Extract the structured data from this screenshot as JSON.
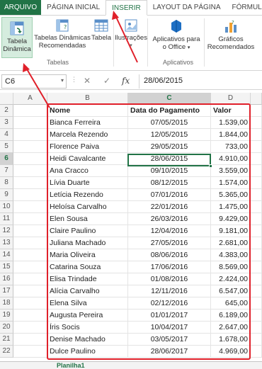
{
  "ribbon_tabs": [
    "ARQUIVO",
    "PÁGINA INICIAL",
    "INSERIR",
    "LAYOUT DA PÁGINA",
    "FÓRMULAS"
  ],
  "ribbon": {
    "pivot_table_label_1": "Tabela",
    "pivot_table_label_2": "Dinâmica",
    "rec_pivot_label_1": "Tabelas Dinâmicas",
    "rec_pivot_label_2": "Recomendadas",
    "table_label": "Tabela",
    "illustrations_label": "Ilustrações",
    "apps_label_1": "Aplicativos para",
    "apps_label_2": "o Office",
    "charts_label_1": "Gráficos",
    "charts_label_2": "Recomendados",
    "group_tables": "Tabelas",
    "group_apps": "Aplicativos"
  },
  "formula_bar": {
    "name_box": "C6",
    "formula": "28/06/2015",
    "fx": "fx",
    "cancel": "✕",
    "confirm": "✓"
  },
  "columns": [
    "A",
    "B",
    "C",
    "D"
  ],
  "row_numbers": [
    "2",
    "3",
    "4",
    "5",
    "6",
    "7",
    "8",
    "9",
    "10",
    "11",
    "12",
    "13",
    "14",
    "15",
    "16",
    "17",
    "18",
    "19",
    "20",
    "21",
    "22"
  ],
  "headers": {
    "name": "Nome",
    "date": "Data do Pagamento",
    "value": "Valor"
  },
  "rows": [
    {
      "name": "Bianca Ferreira",
      "date": "07/05/2015",
      "value": "1.539,00"
    },
    {
      "name": "Marcela Rezendo",
      "date": "12/05/2015",
      "value": "1.844,00"
    },
    {
      "name": "Florence Paiva",
      "date": "29/05/2015",
      "value": "733,00"
    },
    {
      "name": "Heidi Cavalcante",
      "date": "28/06/2015",
      "value": "4.910,00"
    },
    {
      "name": "Ana Cracco",
      "date": "09/10/2015",
      "value": "3.559,00"
    },
    {
      "name": "Lívia Duarte",
      "date": "08/12/2015",
      "value": "1.574,00"
    },
    {
      "name": "Letícia Rezendo",
      "date": "07/01/2016",
      "value": "5.365,00"
    },
    {
      "name": "Heloísa Carvalho",
      "date": "22/01/2016",
      "value": "1.475,00"
    },
    {
      "name": "Elen Sousa",
      "date": "26/03/2016",
      "value": "9.429,00"
    },
    {
      "name": "Claire Paulino",
      "date": "12/04/2016",
      "value": "9.181,00"
    },
    {
      "name": "Juliana Machado",
      "date": "27/05/2016",
      "value": "2.681,00"
    },
    {
      "name": "Maria Oliveira",
      "date": "08/06/2016",
      "value": "4.383,00"
    },
    {
      "name": "Catarina Souza",
      "date": "17/06/2016",
      "value": "8.569,00"
    },
    {
      "name": "Elisa Trindade",
      "date": "01/08/2016",
      "value": "2.424,00"
    },
    {
      "name": "Alícia Carvalho",
      "date": "12/11/2016",
      "value": "6.547,00"
    },
    {
      "name": "Elena Silva",
      "date": "02/12/2016",
      "value": "645,00"
    },
    {
      "name": "Augusta Pereira",
      "date": "01/01/2017",
      "value": "6.189,00"
    },
    {
      "name": "Íris Socis",
      "date": "10/04/2017",
      "value": "2.647,00"
    },
    {
      "name": "Denise Machado",
      "date": "03/05/2017",
      "value": "1.678,00"
    },
    {
      "name": "Dulce Paulino",
      "date": "28/06/2017",
      "value": "4.969,00"
    }
  ],
  "sheet_tab": "Planilha1",
  "colors": {
    "excel_green": "#217346",
    "annotation_red": "#e0202a",
    "selected_tab_bg": "#d5ecde"
  }
}
